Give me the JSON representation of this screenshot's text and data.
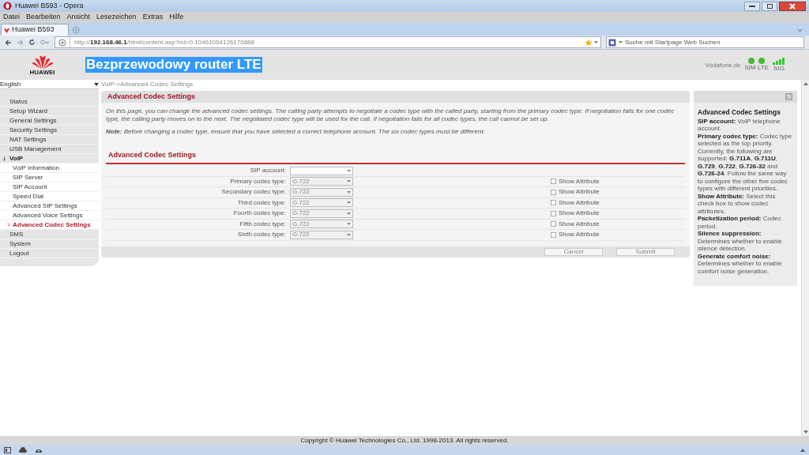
{
  "window": {
    "title": "Huawei B593 - Opera"
  },
  "menu": [
    "Datei",
    "Bearbeiten",
    "Ansicht",
    "Lesezeichen",
    "Extras",
    "Hilfe"
  ],
  "tabs": [
    {
      "label": "Huawei B593",
      "selected": true
    }
  ],
  "address_bar": {
    "url": "http://**192.168.46.1**/html/content.asp?rid=0.10461054126170888"
  },
  "search": {
    "placeholder": "Suche mit Startpage Web Suchen"
  },
  "header": {
    "logo_text": "HUAWEI",
    "title": "Bezprzewodowy router LTE",
    "operator": "Vodafone.de",
    "indicators": [
      {
        "label": "SIM",
        "on": true
      },
      {
        "label": "LTE",
        "on": true
      }
    ],
    "signal_label": "SIG"
  },
  "language": "English",
  "breadcrumb": "VoIP->Advanced Codec Settings",
  "sidebar": {
    "items": [
      {
        "label": "Status",
        "selected": false,
        "expanded": false
      },
      {
        "label": "Setup Wizard",
        "selected": false,
        "expanded": false
      },
      {
        "label": "General Settings",
        "selected": false,
        "expanded": false
      },
      {
        "label": "Security Settings",
        "selected": false,
        "expanded": false
      },
      {
        "label": "NAT Settings",
        "selected": false,
        "expanded": false
      },
      {
        "label": "USB Management",
        "selected": false,
        "expanded": false
      },
      {
        "label": "VoIP",
        "selected": false,
        "expanded": true,
        "children": [
          {
            "label": "VoIP Information",
            "selected": false
          },
          {
            "label": "SIP Server",
            "selected": false
          },
          {
            "label": "SIP Account",
            "selected": false
          },
          {
            "label": "Speed Dial",
            "selected": false
          },
          {
            "label": "Advanced SIP Settings",
            "selected": false
          },
          {
            "label": "Advanced Voice Settings",
            "selected": false
          },
          {
            "label": "Advanced Codec Settings",
            "selected": true
          }
        ]
      },
      {
        "label": "SMS",
        "selected": false,
        "expanded": false
      },
      {
        "label": "System",
        "selected": false,
        "expanded": false
      },
      {
        "label": "Logout",
        "selected": false,
        "expanded": false
      }
    ]
  },
  "panel": {
    "title": "Advanced Codec Settings",
    "intro": "On this page, you can change the advanced codec settings. The calling party attempts to negotiate a codec type with the called party, starting from the primary codec type. If negotiation fails for one codec type, the calling party moves on to the next. The negotiated codec type will be used for the call. If negotiation fails for all codec types, the call cannot be set up.",
    "note": "**Note:** Before changing a codec type, ensure that you have selected a correct telephone account. The six codec types must be different.",
    "section_title": "Advanced Codec Settings",
    "fields": [
      {
        "label": "SIP account:",
        "disabled": false
      },
      {
        "label": "Primary codec type:",
        "value": "G.722",
        "disabled": true,
        "show_attribute": {
          "label": "Show Attribute",
          "checked": false
        }
      },
      {
        "label": "Secondary codec type:",
        "value": "G.722",
        "disabled": true,
        "show_attribute": {
          "label": "Show Attribute",
          "checked": false
        }
      },
      {
        "label": "Third codec type:",
        "value": "G.722",
        "disabled": true,
        "show_attribute": {
          "label": "Show Attribute",
          "checked": false
        }
      },
      {
        "label": "Fourth codec type:",
        "value": "G.722",
        "disabled": true,
        "show_attribute": {
          "label": "Show Attribute",
          "checked": false
        }
      },
      {
        "label": "Fifth codec type:",
        "value": "G.722",
        "disabled": true,
        "show_attribute": {
          "label": "Show Attribute",
          "checked": false
        }
      },
      {
        "label": "Sixth codec type:",
        "value": "G.722",
        "disabled": true,
        "show_attribute": {
          "label": "Show Attribute",
          "checked": false
        }
      }
    ],
    "buttons": [
      {
        "label": "Cancel",
        "disabled": true
      },
      {
        "label": "Submit",
        "disabled": true
      }
    ]
  },
  "help": {
    "title": "Advanced Codec Settings",
    "paragraphs": [
      "**SIP account:** VoIP telephone account.",
      "**Primary codec type:** Codec type selected as the top priority. Currently, the following are supported: **G.711A**, **G.711U**, **G.729**, **G.722**, **G.726-32** and **G.726-24**. Follow the same way to configure the other five codec types with different priorities.",
      "**Show Attribute:** Select this check box to show codec attributes.",
      "**Packetization period:** Codec period.",
      "**Silence suppression:** Determines whether to enable silence detection.",
      "**Generate comfort noise:** Determines whether to enable comfort noise generation."
    ]
  },
  "footer": "Copyright © Huawei Technologies Co., Ltd. 1998-2013. All rights reserved."
}
